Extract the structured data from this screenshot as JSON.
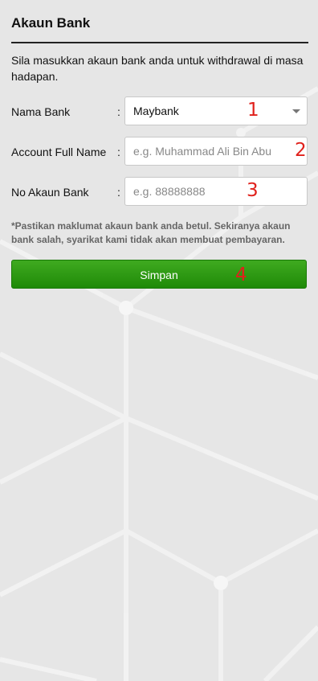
{
  "header": {
    "title": "Akaun Bank"
  },
  "intro": "Sila masukkan akaun bank anda untuk withdrawal di masa hadapan.",
  "form": {
    "bank_name": {
      "label": "Nama Bank",
      "colon": ":",
      "value": "Maybank",
      "marker": "1"
    },
    "full_name": {
      "label": "Account Full Name",
      "colon": ":",
      "placeholder": "e.g. Muhammad Ali Bin Abu",
      "marker": "2"
    },
    "account_no": {
      "label": "No Akaun Bank",
      "colon": ":",
      "placeholder": "e.g. 88888888",
      "marker": "3"
    }
  },
  "note": "*Pastikan maklumat akaun bank anda betul. Sekiranya akaun bank salah, syarikat kami tidak akan membuat pembayaran.",
  "submit": {
    "label": "Simpan",
    "marker": "4"
  },
  "colors": {
    "accent_green": "#2a9a12",
    "marker_red": "#e0211c",
    "background": "#e6e6e6"
  }
}
